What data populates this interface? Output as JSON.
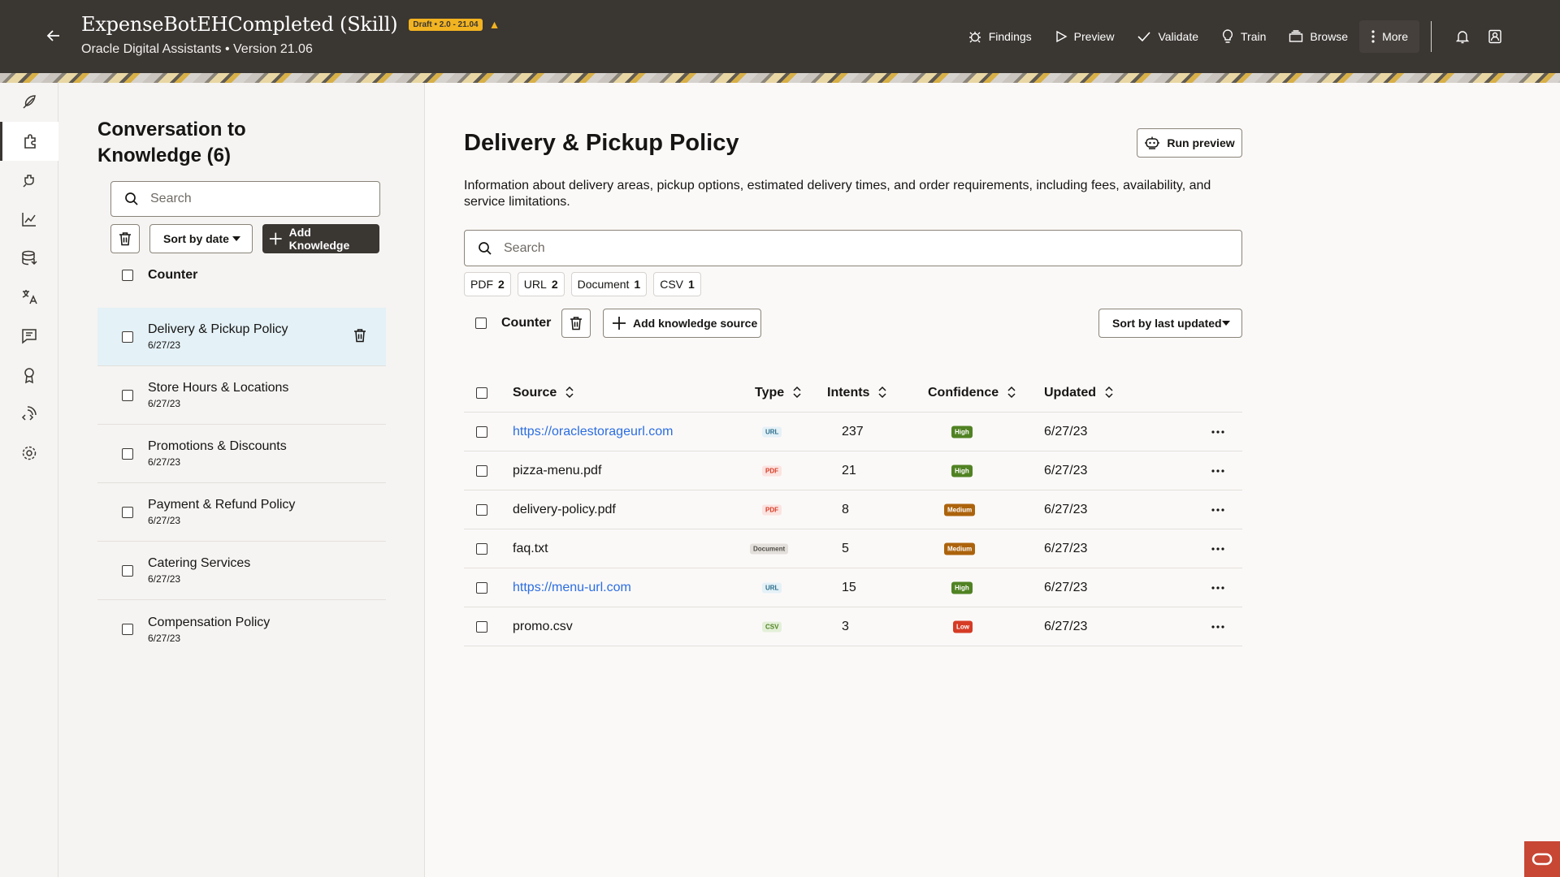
{
  "header": {
    "title": "ExpenseBotEHCompleted (Skill)",
    "badge": "Draft • 2.0 - 21.04",
    "subtitle": "Oracle Digital Assistants • Version 21.06",
    "actions": {
      "findings": "Findings",
      "preview": "Preview",
      "validate": "Validate",
      "train": "Train",
      "browse": "Browse",
      "more": "More"
    }
  },
  "list_panel": {
    "title": "Conversation to Knowledge (6)",
    "search_placeholder": "Search",
    "sort_label": "Sort by date",
    "add_label": "Add Knowledge",
    "counter_label": "Counter",
    "items": [
      {
        "name": "Delivery & Pickup Policy",
        "date": "6/27/23"
      },
      {
        "name": "Store Hours & Locations",
        "date": "6/27/23"
      },
      {
        "name": "Promotions & Discounts",
        "date": "6/27/23"
      },
      {
        "name": "Payment & Refund Policy",
        "date": "6/27/23"
      },
      {
        "name": "Catering Services",
        "date": "6/27/23"
      },
      {
        "name": "Compensation Policy",
        "date": "6/27/23"
      }
    ]
  },
  "main": {
    "title": "Delivery & Pickup Policy",
    "run_preview_label": "Run preview",
    "description": "Information about delivery areas, pickup options, estimated delivery times, and order requirements, including fees, availability, and service limitations.",
    "search_placeholder": "Search",
    "filters": [
      {
        "label": "PDF",
        "count": "2"
      },
      {
        "label": "URL",
        "count": "2"
      },
      {
        "label": "Document",
        "count": "1"
      },
      {
        "label": "CSV",
        "count": "1"
      }
    ],
    "counter_label": "Counter",
    "add_source_label": "Add knowledge source",
    "sort_label": "Sort by last updated",
    "columns": {
      "source": "Source",
      "type": "Type",
      "intents": "Intents",
      "confidence": "Confidence",
      "updated": "Updated"
    },
    "rows": [
      {
        "source": "https://oraclestorageurl.com",
        "type": "URL",
        "intents": "237",
        "confidence": "High",
        "updated": "6/27/23"
      },
      {
        "source": "pizza-menu.pdf",
        "type": "PDF",
        "intents": "21",
        "confidence": "High",
        "updated": "6/27/23"
      },
      {
        "source": "delivery-policy.pdf",
        "type": "PDF",
        "intents": "8",
        "confidence": "Medium",
        "updated": "6/27/23"
      },
      {
        "source": "faq.txt",
        "type": "Document",
        "intents": "5",
        "confidence": "Medium",
        "updated": "6/27/23"
      },
      {
        "source": "https://menu-url.com",
        "type": "URL",
        "intents": "15",
        "confidence": "High",
        "updated": "6/27/23"
      },
      {
        "source": "promo.csv",
        "type": "CSV",
        "intents": "3",
        "confidence": "Low",
        "updated": "6/27/23"
      }
    ]
  },
  "colors": {
    "header_bg": "#3a3632",
    "badge_bg": "#f2b321",
    "link": "#2b6de0",
    "selected_row": "#e4f1f7",
    "conf_high": "#508223",
    "conf_medium": "#ac630c",
    "conf_low": "#d63b25",
    "oracle_red": "#c74634"
  },
  "icons": {
    "rail": [
      "feather-icon",
      "puzzle-icon",
      "plugin-icon",
      "chart-icon",
      "database-icon",
      "translate-icon",
      "chat-icon",
      "award-icon",
      "code-signal-icon",
      "gear-icon"
    ]
  }
}
